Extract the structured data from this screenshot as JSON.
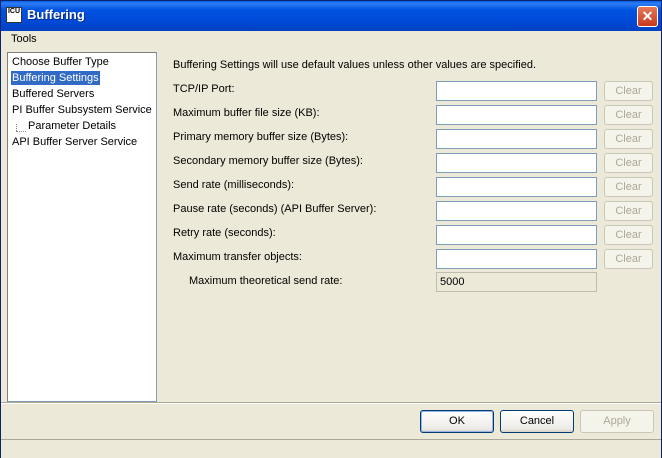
{
  "window": {
    "title": "Buffering",
    "icon_text": "ICU"
  },
  "menu": {
    "tools": "Tools"
  },
  "tree": {
    "items": [
      {
        "label": "Choose Buffer Type",
        "selected": false
      },
      {
        "label": "Buffering Settings",
        "selected": true
      },
      {
        "label": "Buffered Servers",
        "selected": false
      },
      {
        "label": "PI Buffer Subsystem Service",
        "selected": false
      },
      {
        "label": "Parameter Details",
        "selected": false
      },
      {
        "label": "API Buffer Server Service",
        "selected": false
      }
    ]
  },
  "main": {
    "info": "Buffering Settings will use default values unless other values are specified.",
    "rows": [
      {
        "label": "TCP/IP Port:",
        "value": "",
        "clear": "Clear"
      },
      {
        "label": "Maximum buffer file size (KB):",
        "value": "",
        "clear": "Clear"
      },
      {
        "label": "Primary memory buffer size (Bytes):",
        "value": "",
        "clear": "Clear"
      },
      {
        "label": "Secondary memory buffer size (Bytes):",
        "value": "",
        "clear": "Clear"
      },
      {
        "label": "Send rate (milliseconds):",
        "value": "",
        "clear": "Clear"
      },
      {
        "label": "Pause rate (seconds) (API Buffer Server):",
        "value": "",
        "clear": "Clear"
      },
      {
        "label": "Retry rate (seconds):",
        "value": "",
        "clear": "Clear"
      },
      {
        "label": "Maximum transfer objects:",
        "value": "",
        "clear": "Clear"
      }
    ],
    "max_send_rate": {
      "label": "Maximum theoretical send rate:",
      "value": "5000"
    }
  },
  "buttons": {
    "ok": "OK",
    "cancel": "Cancel",
    "apply": "Apply"
  }
}
